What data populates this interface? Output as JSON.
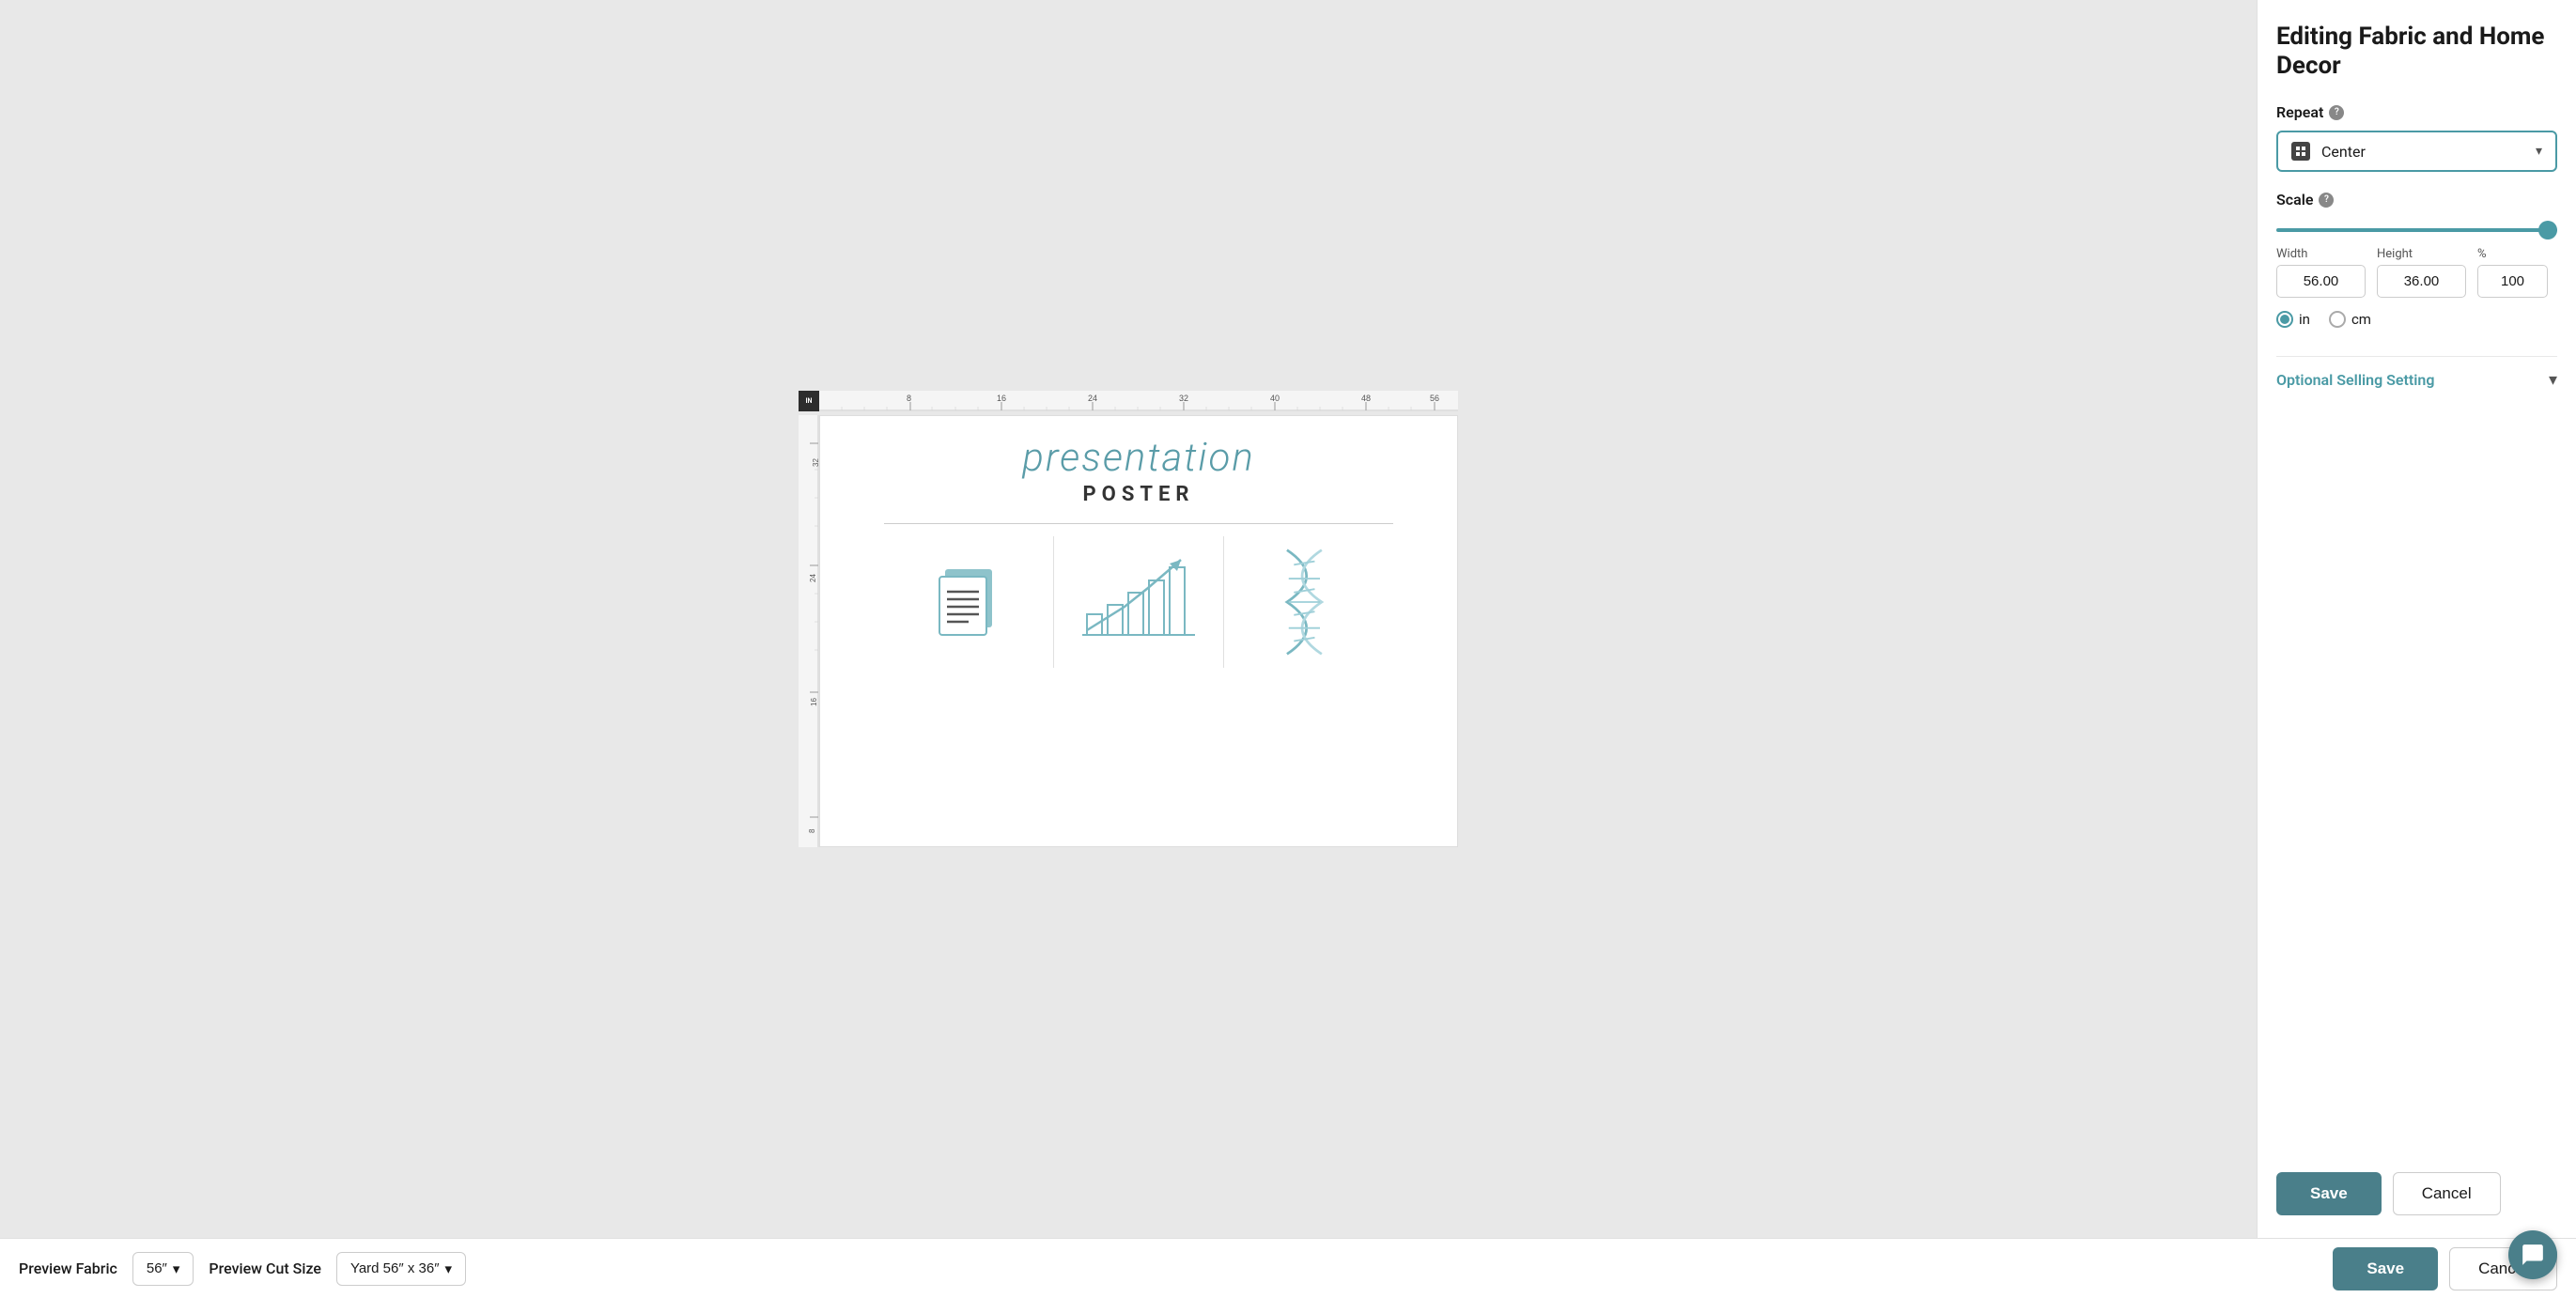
{
  "header": {
    "title": "Editing Fabric and Home Decor"
  },
  "right_panel": {
    "title": "Editing Fabric and\nHome Decor",
    "repeat_label": "Repeat",
    "repeat_value": "Center",
    "scale_label": "Scale",
    "width_label": "Width",
    "height_label": "Height",
    "percent_label": "%",
    "width_value": "56.00",
    "height_value": "36.00",
    "percent_value": "100",
    "unit_in": "in",
    "unit_cm": "cm",
    "optional_label": "Optional Selling Setting",
    "save_label": "Save",
    "cancel_label": "Cancel"
  },
  "bottom_bar": {
    "preview_fabric_label": "Preview Fabric",
    "preview_size_label": "Preview Cut Size",
    "fabric_size_value": "56″",
    "cut_size_value": "Yard 56″ x 36″"
  },
  "canvas": {
    "unit_label": "IN",
    "ruler_top_ticks": [
      8,
      16,
      24,
      32,
      40,
      48,
      56
    ],
    "ruler_left_ticks": [
      8,
      16,
      24,
      32
    ],
    "poster_title": "presentation",
    "poster_subtitle": "POSTER"
  }
}
